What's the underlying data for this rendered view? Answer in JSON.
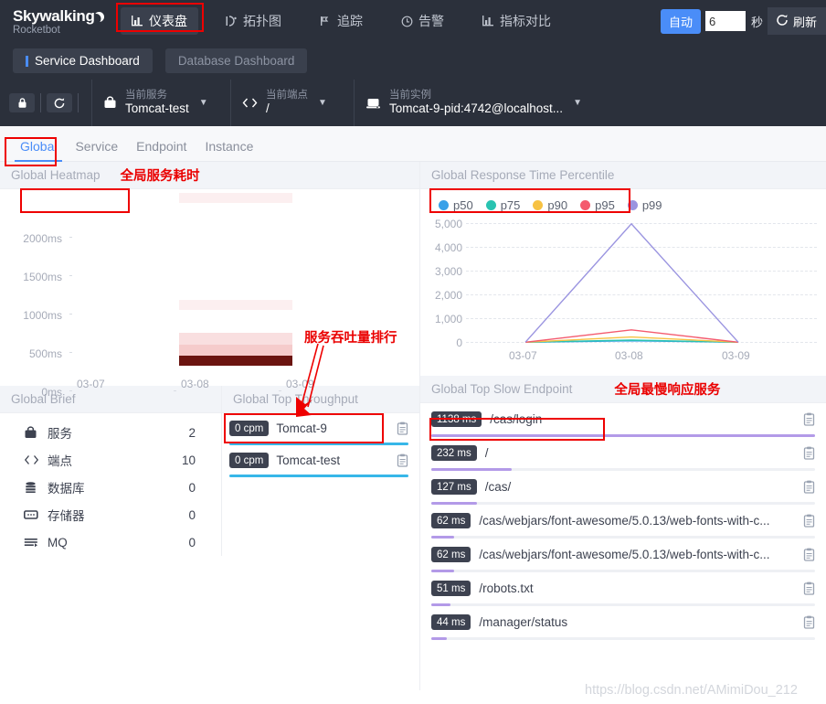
{
  "brand": {
    "name": "Skywalking",
    "sub": "Rocketbot"
  },
  "topnav": {
    "items": [
      {
        "label": "仪表盘",
        "icon": "bar-chart-icon",
        "active": true
      },
      {
        "label": "拓扑图",
        "icon": "topology-icon",
        "active": false
      },
      {
        "label": "追踪",
        "icon": "trace-icon",
        "active": false
      },
      {
        "label": "告警",
        "icon": "alarm-icon",
        "active": false
      },
      {
        "label": "指标对比",
        "icon": "compare-icon",
        "active": false
      }
    ],
    "auto_label": "自动",
    "interval_value": "6",
    "seconds_label": "秒",
    "refresh_label": "刷新",
    "accent": "#4a8df8"
  },
  "dashboard_tabs": [
    {
      "label": "Service Dashboard",
      "active": true
    },
    {
      "label": "Database Dashboard",
      "active": false
    }
  ],
  "selector_bar": {
    "icons": [
      {
        "name": "lock-icon"
      },
      {
        "name": "sync-icon"
      }
    ],
    "groups": [
      {
        "icon": "service-icon",
        "label": "当前服务",
        "value": "Tomcat-test"
      },
      {
        "icon": "endpoint-icon",
        "label": "当前端点",
        "value": "/"
      },
      {
        "icon": "instance-icon",
        "label": "当前实例",
        "value": "Tomcat-9-pid:4742@localhost..."
      }
    ]
  },
  "sub_tabs": [
    {
      "label": "Global",
      "active": true
    },
    {
      "label": "Service",
      "active": false
    },
    {
      "label": "Endpoint",
      "active": false
    },
    {
      "label": "Instance",
      "active": false
    }
  ],
  "panels": {
    "heatmap_title": "Global Heatmap",
    "heatmap_note": "全局服务耗时",
    "percentile_title": "Global Response Time Percentile",
    "brief_title": "Global Brief",
    "throughput_title": "Global Top Throughput",
    "throughput_note": "服务吞吐量排行",
    "slow_title": "Global Top Slow Endpoint",
    "slow_note": "全局最慢响应服务"
  },
  "global_brief": [
    {
      "icon": "service-icon",
      "label": "服务",
      "value": "2"
    },
    {
      "icon": "endpoint-icon",
      "label": "端点",
      "value": "10"
    },
    {
      "icon": "database-icon",
      "label": "数据库",
      "value": "0"
    },
    {
      "icon": "cache-icon",
      "label": "存储器",
      "value": "0"
    },
    {
      "icon": "mq-icon",
      "label": "MQ",
      "value": "0"
    }
  ],
  "top_throughput": [
    {
      "badge": "0 cpm",
      "name": "Tomcat-9",
      "pct": 100,
      "color": "#37b7e8"
    },
    {
      "badge": "0 cpm",
      "name": "Tomcat-test",
      "pct": 100,
      "color": "#37b7e8"
    }
  ],
  "top_slow_endpoints": [
    {
      "badge": "1138 ms",
      "name": "/cas/login",
      "pct": 100
    },
    {
      "badge": "232 ms",
      "name": "/",
      "pct": 21
    },
    {
      "badge": "127 ms",
      "name": "/cas/",
      "pct": 12
    },
    {
      "badge": "62 ms",
      "name": "/cas/webjars/font-awesome/5.0.13/web-fonts-with-c...",
      "pct": 6
    },
    {
      "badge": "62 ms",
      "name": "/cas/webjars/font-awesome/5.0.13/web-fonts-with-c...",
      "pct": 6
    },
    {
      "badge": "51 ms",
      "name": "/robots.txt",
      "pct": 5
    },
    {
      "badge": "44 ms",
      "name": "/manager/status",
      "pct": 4
    }
  ],
  "watermark": "https://blog.csdn.net/AMimiDou_212",
  "chart_data": [
    {
      "type": "heatmap",
      "title": "Global Heatmap",
      "xlabel": "",
      "ylabel": "",
      "x": [
        "03-07",
        "03-08",
        "03-09"
      ],
      "ytick_labels": [
        "0ms",
        "500ms",
        "1000ms",
        "1500ms",
        "2000ms"
      ],
      "ylim": [
        0,
        2200
      ],
      "grid": false,
      "cells": [
        {
          "x": "03-08",
          "y_from": 1900,
          "y_to": 2100,
          "color": "#fceff0",
          "value": 1
        },
        {
          "x": "03-08",
          "y_from": 430,
          "y_to": 560,
          "color": "#fceff0",
          "value": 1
        },
        {
          "x": "03-08",
          "y_from": 180,
          "y_to": 300,
          "color": "#f9dfe0",
          "value": 2
        },
        {
          "x": "03-08",
          "y_from": 90,
          "y_to": 180,
          "color": "#f5cbcb",
          "value": 3
        },
        {
          "x": "03-08",
          "y_from": 0,
          "y_to": 90,
          "color": "#6b1410",
          "value": 9
        }
      ]
    },
    {
      "type": "line",
      "title": "Global Response Time Percentile",
      "xlabel": "",
      "ylabel": "",
      "x": [
        "03-07",
        "03-08",
        "03-09"
      ],
      "ylim": [
        0,
        5400
      ],
      "ytick_labels": [
        "0",
        "1,000",
        "2,000",
        "3,000",
        "4,000",
        "5,000"
      ],
      "grid": true,
      "legend_position": "top-left",
      "series": [
        {
          "name": "p50",
          "color": "#3aa1e8",
          "values": [
            0,
            60,
            0
          ]
        },
        {
          "name": "p75",
          "color": "#29c3b1",
          "values": [
            0,
            90,
            0
          ]
        },
        {
          "name": "p90",
          "color": "#f7c243",
          "values": [
            0,
            220,
            0
          ]
        },
        {
          "name": "p95",
          "color": "#f45b6e",
          "values": [
            0,
            520,
            0
          ]
        },
        {
          "name": "p99",
          "color": "#9a94e0",
          "values": [
            0,
            4980,
            0
          ]
        }
      ]
    }
  ]
}
